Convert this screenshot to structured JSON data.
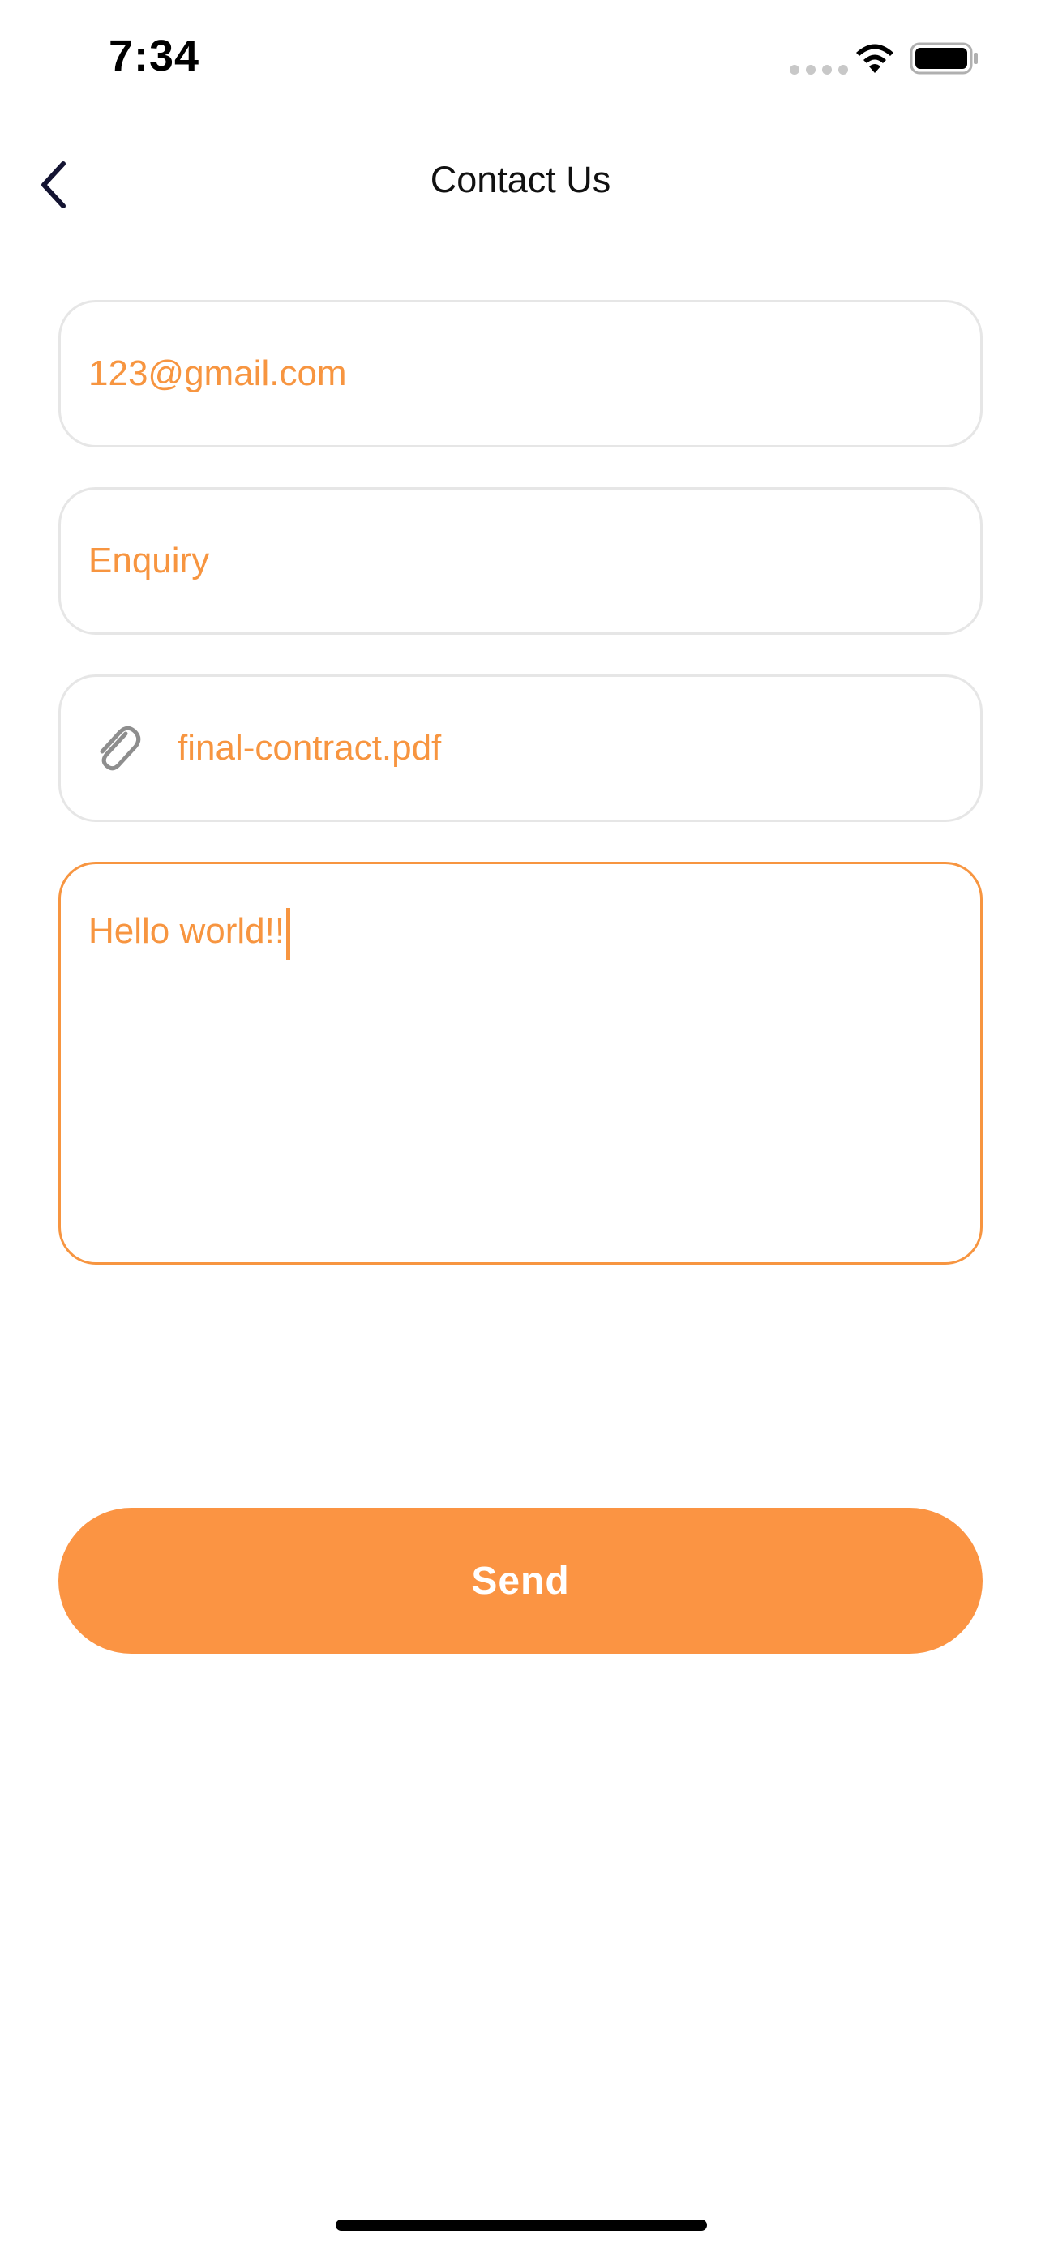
{
  "status_bar": {
    "time": "7:34",
    "icons": [
      "signal-icon",
      "wifi-icon",
      "battery-icon"
    ]
  },
  "header": {
    "back_icon": "chevron-left-icon",
    "title": "Contact Us"
  },
  "form": {
    "email_value": "123@gmail.com",
    "subject_value": "Enquiry",
    "attachment_icon": "paperclip-icon",
    "attachment_value": "final-contract.pdf",
    "message_value": "Hello world!!"
  },
  "actions": {
    "send_label": "Send"
  },
  "colors": {
    "accent": "#f79540",
    "button": "#fb9443",
    "border": "#e6e6e6",
    "title": "#111111"
  }
}
